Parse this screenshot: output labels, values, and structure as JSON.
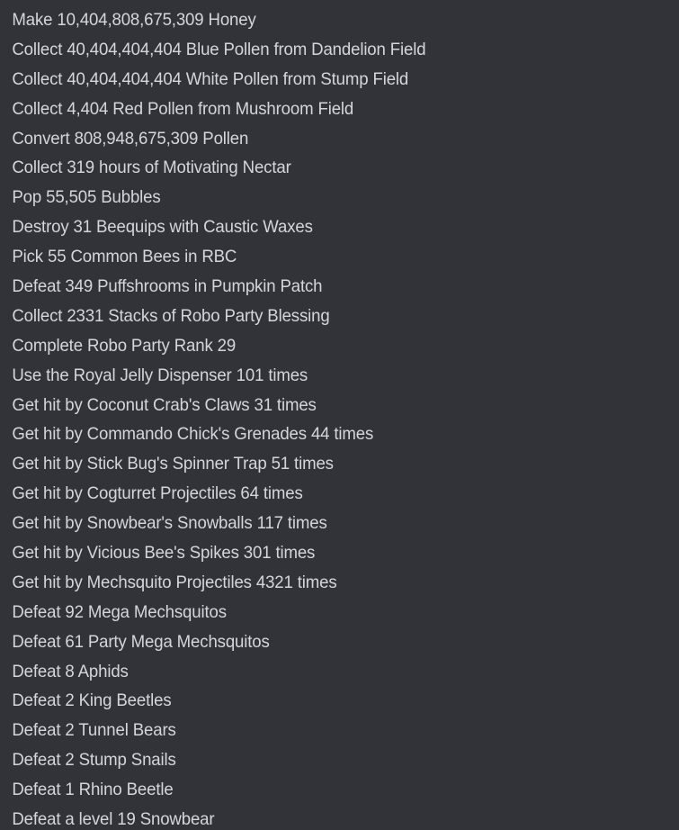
{
  "panel": {
    "name": "quest-objective-list",
    "background_color": "#313338",
    "text_color": "#d3d7dc"
  },
  "quests": [
    {
      "text": "Make 10,404,808,675,309 Honey"
    },
    {
      "text": "Collect 40,404,404,404 Blue Pollen from Dandelion Field"
    },
    {
      "text": "Collect 40,404,404,404 White Pollen from Stump Field"
    },
    {
      "text": "Collect 4,404 Red Pollen from Mushroom Field"
    },
    {
      "text": "Convert 808,948,675,309 Pollen"
    },
    {
      "text": "Collect 319 hours of Motivating Nectar"
    },
    {
      "text": "Pop 55,505 Bubbles"
    },
    {
      "text": "Destroy 31 Beequips with Caustic Waxes"
    },
    {
      "text": "Pick 55 Common Bees in RBC"
    },
    {
      "text": "Defeat 349 Puffshrooms in Pumpkin Patch"
    },
    {
      "text": "Collect 2331 Stacks of Robo Party Blessing"
    },
    {
      "text": "Complete Robo Party Rank 29"
    },
    {
      "text": "Use the Royal Jelly Dispenser 101 times"
    },
    {
      "text": "Get hit by Coconut Crab's Claws 31 times"
    },
    {
      "text": "Get hit by Commando Chick's Grenades 44 times"
    },
    {
      "text": "Get hit by Stick Bug's Spinner Trap 51 times"
    },
    {
      "text": "Get hit by Cogturret Projectiles 64 times"
    },
    {
      "text": "Get hit by Snowbear's Snowballs 117 times"
    },
    {
      "text": "Get hit by Vicious Bee's Spikes 301 times"
    },
    {
      "text": "Get hit by Mechsquito Projectiles 4321 times"
    },
    {
      "text": "Defeat 92 Mega Mechsquitos"
    },
    {
      "text": "Defeat 61 Party Mega Mechsquitos"
    },
    {
      "text": "Defeat 8 Aphids"
    },
    {
      "text": "Defeat 2 King Beetles"
    },
    {
      "text": "Defeat 2 Tunnel Bears"
    },
    {
      "text": "Defeat 2 Stump Snails"
    },
    {
      "text": "Defeat 1 Rhino Beetle"
    },
    {
      "text": "Defeat a level 19 Snowbear"
    }
  ]
}
